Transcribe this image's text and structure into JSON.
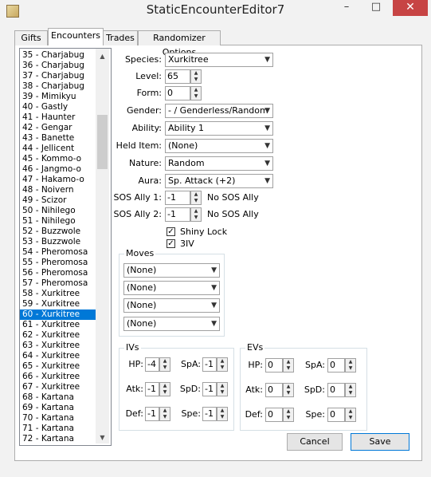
{
  "window": {
    "title": "StaticEncounterEditor7",
    "min": "–",
    "max": "□",
    "close": "✕"
  },
  "tabs": [
    "Gifts",
    "Encounters",
    "Trades",
    "Randomizer Options"
  ],
  "list": {
    "items": [
      "35 - Charjabug",
      "36 - Charjabug",
      "37 - Charjabug",
      "38 - Charjabug",
      "39 - Mimikyu",
      "40 - Gastly",
      "41 - Haunter",
      "42 - Gengar",
      "43 - Banette",
      "44 - Jellicent",
      "45 - Kommo-o",
      "46 - Jangmo-o",
      "47 - Hakamo-o",
      "48 - Noivern",
      "49 - Scizor",
      "50 - Nihilego",
      "51 - Nihilego",
      "52 - Buzzwole",
      "53 - Buzzwole",
      "54 - Pheromosa",
      "55 - Pheromosa",
      "56 - Pheromosa",
      "57 - Pheromosa",
      "58 - Xurkitree",
      "59 - Xurkitree",
      "60 - Xurkitree",
      "61 - Xurkitree",
      "62 - Xurkitree",
      "63 - Xurkitree",
      "64 - Xurkitree",
      "65 - Xurkitree",
      "66 - Xurkitree",
      "67 - Xurkitree",
      "68 - Kartana",
      "69 - Kartana",
      "70 - Kartana",
      "71 - Kartana",
      "72 - Kartana"
    ],
    "selected": "60 - Xurkitree"
  },
  "form": {
    "species_label": "Species:",
    "species": "Xurkitree",
    "level_label": "Level:",
    "level": "65",
    "form_label": "Form:",
    "form": "0",
    "gender_label": "Gender:",
    "gender": "- / Genderless/Random",
    "ability_label": "Ability:",
    "ability": "Ability 1",
    "helditem_label": "Held Item:",
    "helditem": "(None)",
    "nature_label": "Nature:",
    "nature": "Random",
    "aura_label": "Aura:",
    "aura": "Sp. Attack (+2)",
    "sos1_label": "SOS Ally 1:",
    "sos1": "-1",
    "sos1_text": "No SOS Ally",
    "sos2_label": "SOS Ally 2:",
    "sos2": "-1",
    "sos2_text": "No SOS Ally",
    "shiny_label": "Shiny Lock",
    "iv3_label": "3IV"
  },
  "moves": {
    "title": "Moves",
    "values": [
      "(None)",
      "(None)",
      "(None)",
      "(None)"
    ]
  },
  "ivs": {
    "title": "IVs",
    "hp_label": "HP:",
    "hp": "-4",
    "spa_label": "SpA:",
    "spa": "-1",
    "atk_label": "Atk:",
    "atk": "-1",
    "spd_label": "SpD:",
    "spd": "-1",
    "def_label": "Def:",
    "def": "-1",
    "spe_label": "Spe:",
    "spe": "-1"
  },
  "evs": {
    "title": "EVs",
    "hp_label": "HP:",
    "hp": "0",
    "spa_label": "SpA:",
    "spa": "0",
    "atk_label": "Atk:",
    "atk": "0",
    "spd_label": "SpD:",
    "spd": "0",
    "def_label": "Def:",
    "def": "0",
    "spe_label": "Spe:",
    "spe": "0"
  },
  "buttons": {
    "cancel": "Cancel",
    "save": "Save"
  }
}
